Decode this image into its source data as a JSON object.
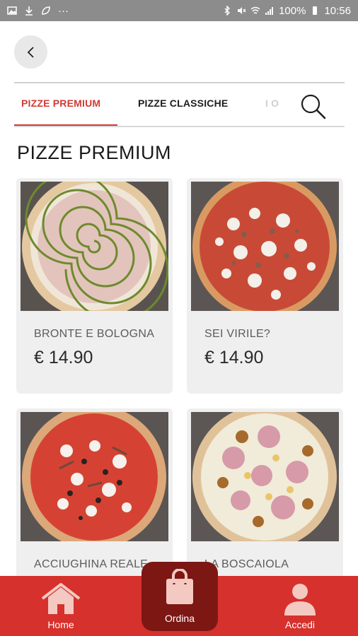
{
  "status_bar": {
    "battery": "100%",
    "time": "10:56",
    "dots": "···"
  },
  "header": {
    "back_icon": "chevron-left-icon"
  },
  "tabs": [
    {
      "label": "PIZZE PREMIUM",
      "active": true
    },
    {
      "label": "PIZZE CLASSICHE",
      "active": false
    },
    {
      "label": "I O",
      "active": false
    }
  ],
  "search": {
    "icon": "search-icon"
  },
  "section": {
    "title": "PIZZE PREMIUM"
  },
  "products": [
    {
      "name": "BRONTE E BOLOGNA",
      "price": "€ 14.90"
    },
    {
      "name": "SEI VIRILE?",
      "price": "€ 14.90"
    },
    {
      "name": "ACCIUGHINA REALE",
      "price": ""
    },
    {
      "name": "LA BOSCAIOLA",
      "price": ""
    }
  ],
  "bottom_nav": {
    "home": "Home",
    "order": "Ordina",
    "login": "Accedi"
  },
  "colors": {
    "accent": "#d23a33",
    "nav_bg": "#d6312c",
    "order_bg": "#7c1714"
  }
}
